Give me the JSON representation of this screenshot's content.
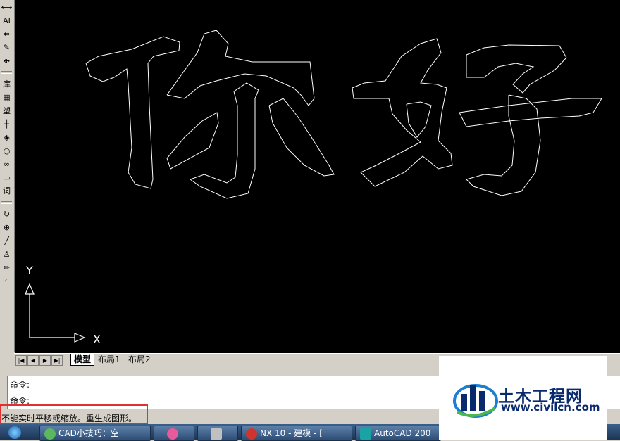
{
  "toolbar": {
    "tools": [
      {
        "icon": "dimension-icon",
        "glyph": "⟷"
      },
      {
        "icon": "text-icon",
        "glyph": "AI"
      },
      {
        "icon": "stretch-icon",
        "glyph": "⇔"
      },
      {
        "icon": "pen-icon",
        "glyph": "✎"
      },
      {
        "icon": "symmetry-icon",
        "glyph": "⇹"
      },
      {
        "icon": "library-icon",
        "glyph": "库"
      },
      {
        "icon": "table-icon",
        "glyph": "▦"
      },
      {
        "icon": "plastic-icon",
        "glyph": "塑"
      },
      {
        "icon": "axis-icon",
        "glyph": "┼"
      },
      {
        "icon": "snap-icon",
        "glyph": "◈"
      },
      {
        "icon": "circle-icon",
        "glyph": "○"
      },
      {
        "icon": "chain-icon",
        "glyph": "∞"
      },
      {
        "icon": "monitor-icon",
        "glyph": "▭"
      },
      {
        "icon": "word-icon",
        "glyph": "词"
      },
      {
        "icon": "rotate-icon",
        "glyph": "↻"
      },
      {
        "icon": "zoom-icon",
        "glyph": "⊕"
      },
      {
        "icon": "line-icon",
        "glyph": "╱"
      },
      {
        "icon": "stamp-icon",
        "glyph": "♙"
      },
      {
        "icon": "pencil-icon",
        "glyph": "✏"
      },
      {
        "icon": "arc-icon",
        "glyph": "◜"
      }
    ]
  },
  "canvas": {
    "glyphs": "你好",
    "ucs": {
      "y_label": "Y",
      "x_label": "X"
    }
  },
  "tabs": {
    "nav": [
      "|◀",
      "◀",
      "▶",
      "▶|"
    ],
    "items": [
      {
        "label": "模型",
        "active": true
      },
      {
        "label": "布局1",
        "active": false
      },
      {
        "label": "布局2",
        "active": false
      }
    ]
  },
  "command": {
    "line1": "命令:",
    "line2": "命令:"
  },
  "status": {
    "message": "不能实时平移或缩放。重生成图形。"
  },
  "watermark": {
    "title": "土木工程网",
    "url": "www.civilcn.com"
  },
  "taskbar": {
    "items": [
      {
        "label": "CAD小技巧：空",
        "icon_color": "#5cb85c"
      },
      {
        "label": "",
        "icon_color": "#e85a9a"
      },
      {
        "label": "",
        "icon_color": "#c0c0c0"
      },
      {
        "label": "NX 10 - 建模 - [",
        "icon_color": "#d0342c"
      },
      {
        "label": "AutoCAD 200",
        "icon_color": "#1aa3a3"
      }
    ]
  },
  "colors": {
    "canvas_bg": "#000000",
    "glyph_stroke": "#ffffff",
    "highlight": "#e03030"
  }
}
